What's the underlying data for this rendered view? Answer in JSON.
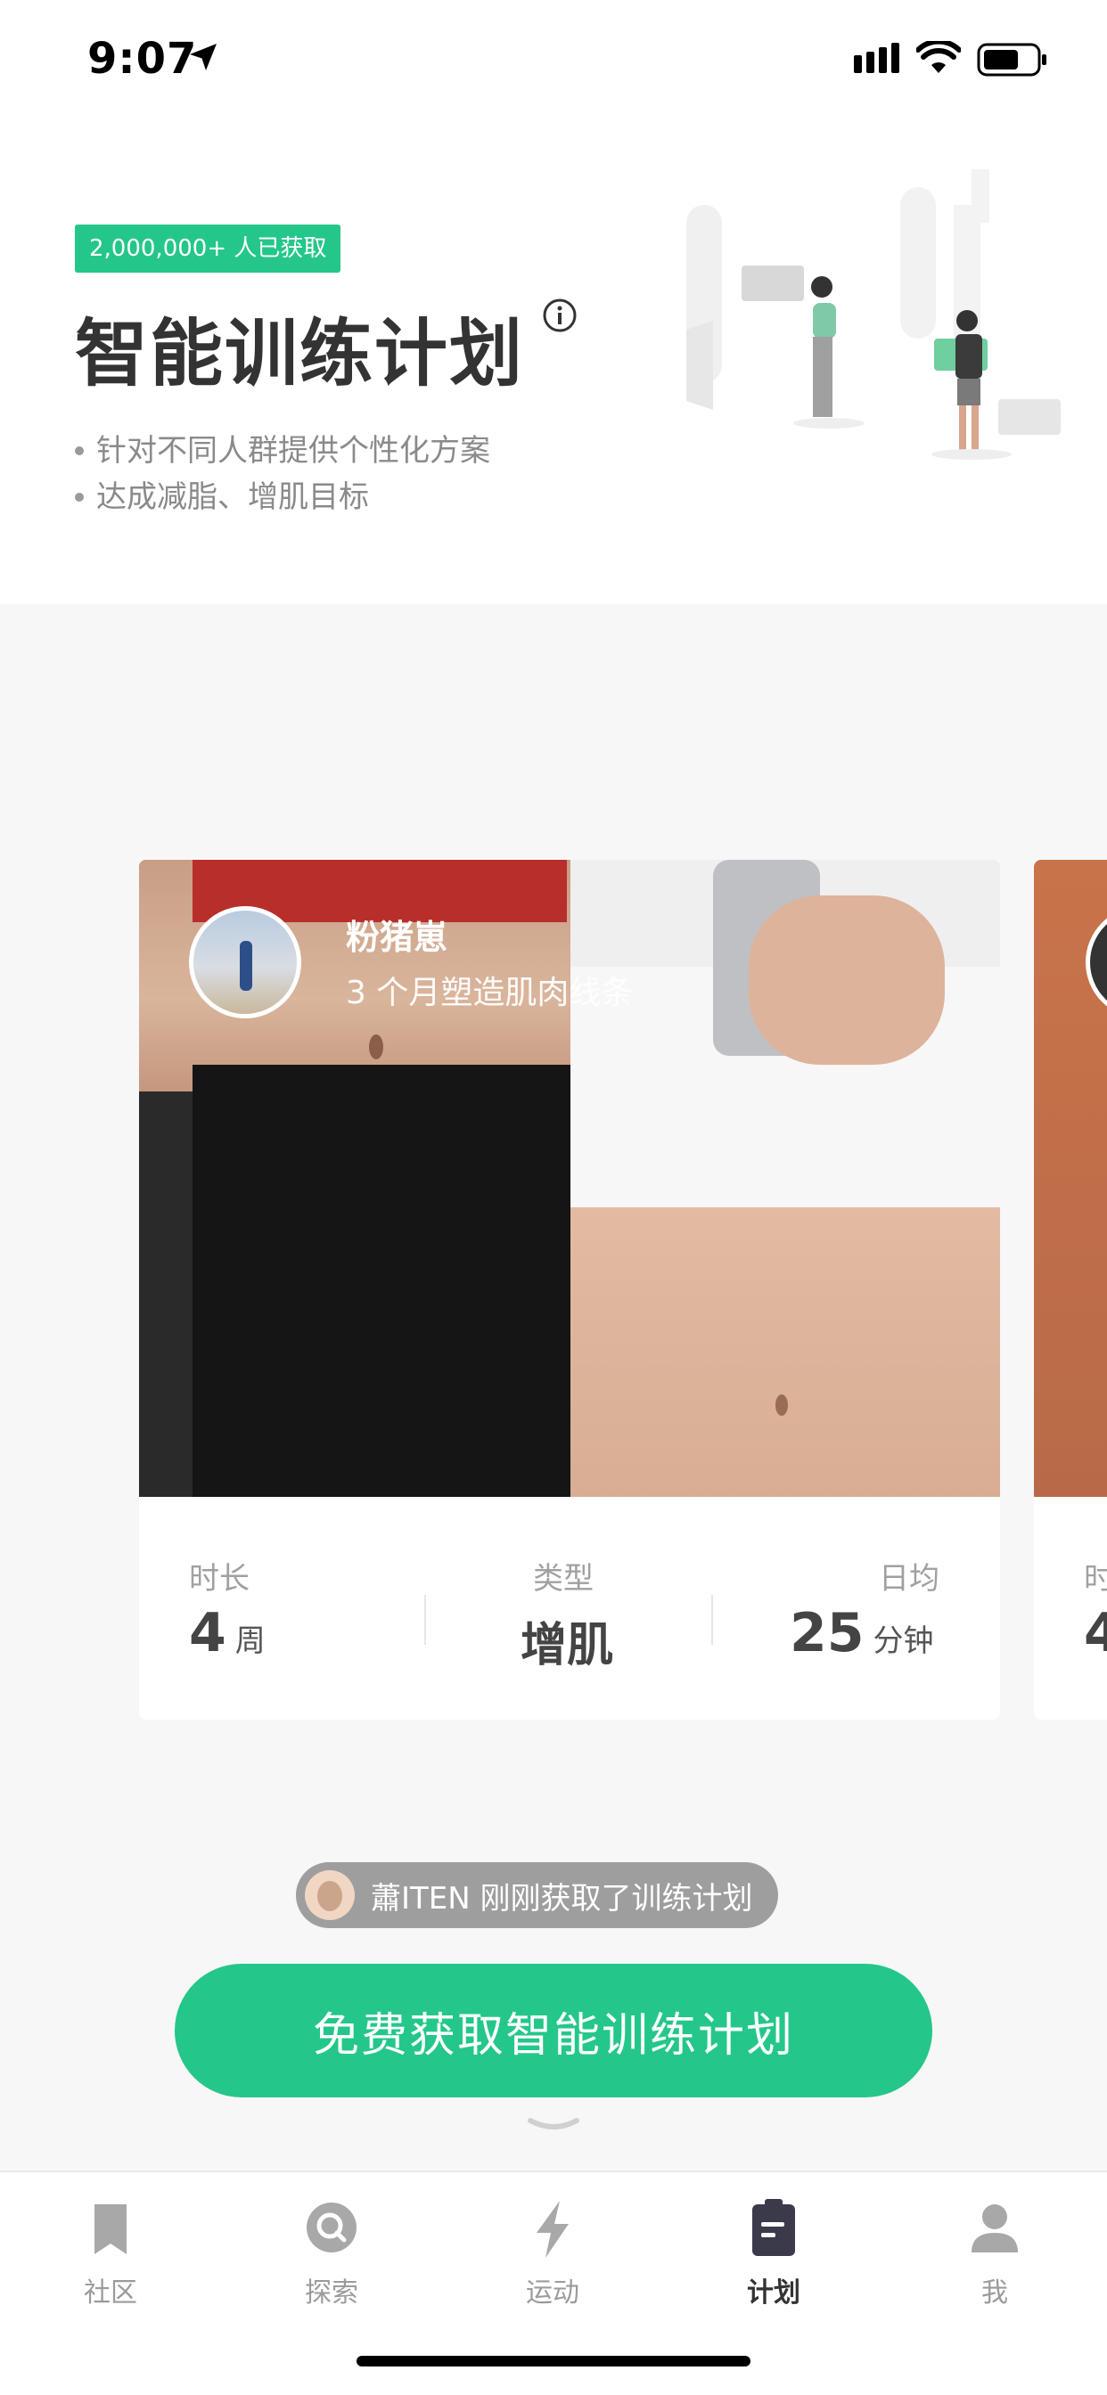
{
  "status_bar": {
    "time": "9:07"
  },
  "header": {
    "badge": "2,000,000+ 人已获取",
    "title": "智能训练计划",
    "bullets": [
      "针对不同人群提供个性化方案",
      "达成减脂、增肌目标"
    ]
  },
  "card": {
    "user_name": "粉猪崽",
    "user_desc": "3 个月塑造肌肉线条",
    "stats": [
      {
        "label": "时长",
        "value": "4",
        "unit": "周"
      },
      {
        "label": "类型",
        "value": "增肌",
        "unit": ""
      },
      {
        "label": "日均",
        "value": "25",
        "unit": "分钟"
      }
    ]
  },
  "peek_card": {
    "label": "时",
    "value": "4"
  },
  "notice": {
    "text": "蕭ITEN 刚刚获取了训练计划"
  },
  "cta": {
    "label": "免费获取智能训练计划"
  },
  "tabbar": {
    "items": [
      {
        "label": "社区",
        "icon": "bookmark-icon",
        "active": false
      },
      {
        "label": "探索",
        "icon": "search-icon",
        "active": false
      },
      {
        "label": "运动",
        "icon": "lightning-icon",
        "active": false
      },
      {
        "label": "计划",
        "icon": "clipboard-icon",
        "active": true
      },
      {
        "label": "我",
        "icon": "profile-icon",
        "active": false
      }
    ]
  },
  "colors": {
    "accent": "#24c789",
    "tab_active": "#333333",
    "tab_inactive": "#9b9b9b"
  }
}
